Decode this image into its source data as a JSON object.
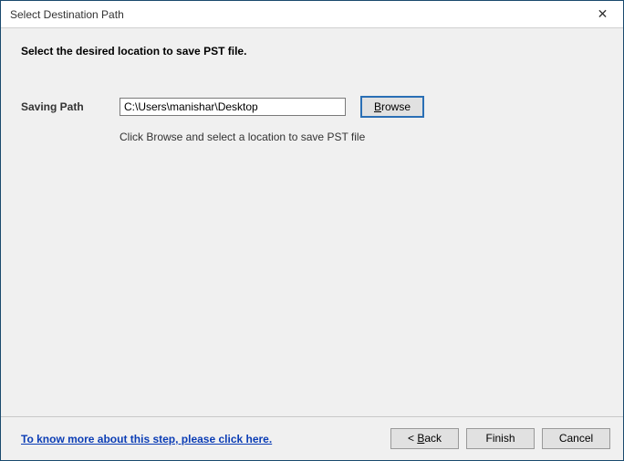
{
  "window": {
    "title": "Select Destination Path",
    "close_glyph": "✕"
  },
  "instruction": "Select the desired location to save PST file.",
  "path": {
    "label": "Saving Path",
    "value": "C:\\Users\\manishar\\Desktop",
    "browse_prefix": "B",
    "browse_rest": "rowse",
    "hint": "Click Browse and select a location to save PST file"
  },
  "footer": {
    "help_link": "To know more about this step, please click here.",
    "back_prefix": "< ",
    "back_mn": "B",
    "back_rest": "ack",
    "finish": "Finish",
    "cancel": "Cancel"
  }
}
